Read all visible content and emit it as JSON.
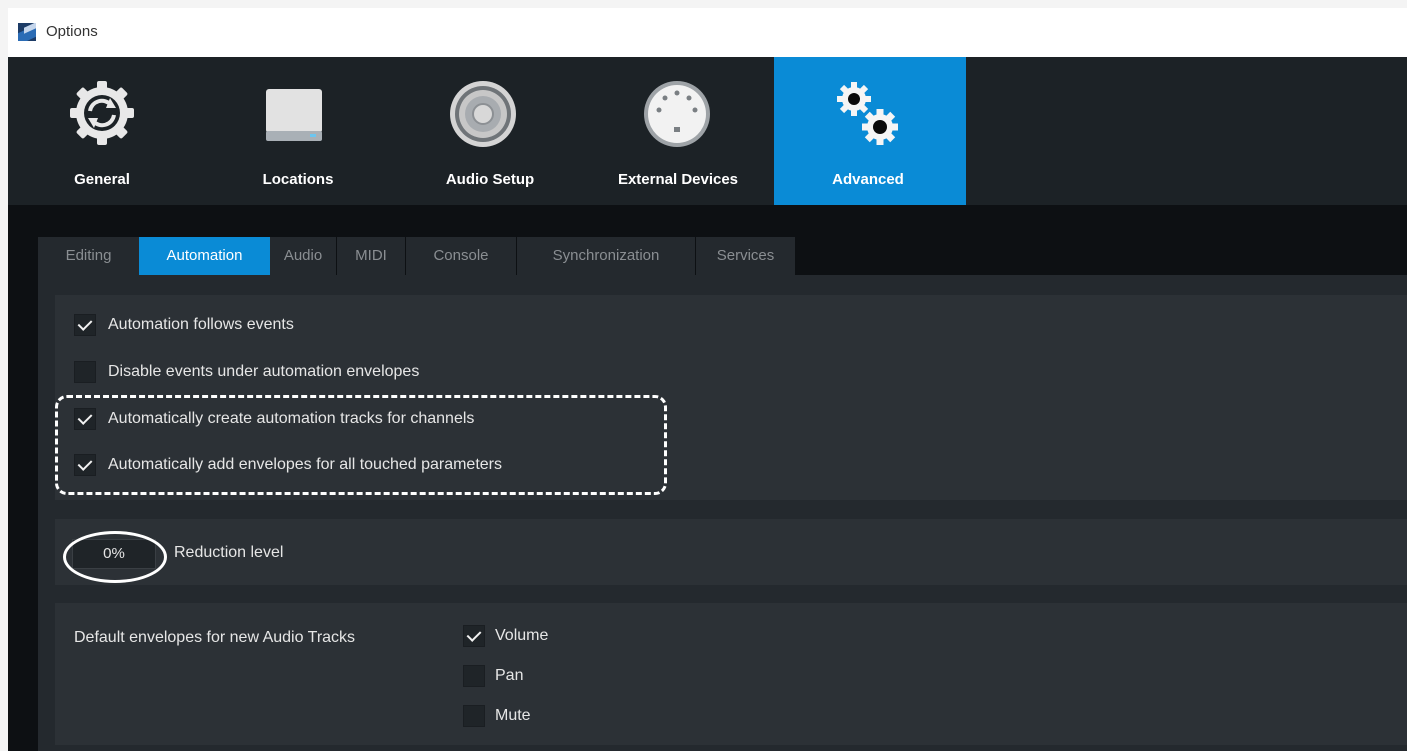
{
  "window": {
    "title": "Options"
  },
  "toolbar": {
    "items": [
      {
        "label": "General",
        "icon": "gear-sync-icon"
      },
      {
        "label": "Locations",
        "icon": "drive-icon"
      },
      {
        "label": "Audio Setup",
        "icon": "speaker-icon"
      },
      {
        "label": "External Devices",
        "icon": "midi-connector-icon"
      },
      {
        "label": "Advanced",
        "icon": "gears-icon",
        "active": true
      }
    ]
  },
  "tabs": [
    {
      "label": "Editing"
    },
    {
      "label": "Automation",
      "active": true
    },
    {
      "label": "Audio"
    },
    {
      "label": "MIDI"
    },
    {
      "label": "Console"
    },
    {
      "label": "Synchronization"
    },
    {
      "label": "Services"
    }
  ],
  "automation": {
    "options": [
      {
        "label": "Automation follows events",
        "checked": true
      },
      {
        "label": "Disable events under automation envelopes",
        "checked": false
      },
      {
        "label": "Automatically create automation tracks for channels",
        "checked": true
      },
      {
        "label": "Automatically add envelopes for all touched parameters",
        "checked": true
      }
    ],
    "reduction": {
      "value": "0%",
      "label": "Reduction level"
    },
    "default_envelopes": {
      "label": "Default envelopes for new Audio Tracks",
      "items": [
        {
          "label": "Volume",
          "checked": true
        },
        {
          "label": "Pan",
          "checked": false
        },
        {
          "label": "Mute",
          "checked": false
        }
      ]
    }
  },
  "colors": {
    "accent": "#0a8bd6",
    "panel": "#2c3136",
    "background": "#1e2328"
  }
}
